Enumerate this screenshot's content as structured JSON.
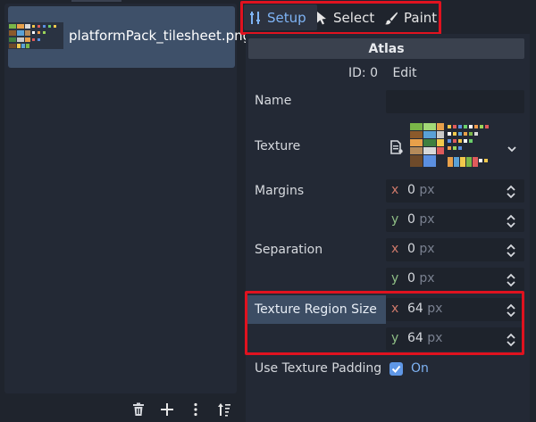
{
  "sidebar": {
    "atlas_item": {
      "name": "platformPack_tilesheet.png",
      "thumb_icon": "tilesheet-thumbnail"
    }
  },
  "bottom_toolbar": {
    "buttons": [
      {
        "icon": "trash-icon"
      },
      {
        "icon": "plus-icon"
      },
      {
        "icon": "kebab-menu-icon"
      },
      {
        "icon": "sort-icon"
      }
    ]
  },
  "mode_tabs": [
    {
      "label": "Setup",
      "icon": "setup-tools-icon",
      "active": true
    },
    {
      "label": "Select",
      "icon": "cursor-icon",
      "active": false
    },
    {
      "label": "Paint",
      "icon": "brush-icon",
      "active": false
    }
  ],
  "inspector": {
    "header": "Atlas",
    "id_label": "ID: 0",
    "edit_label": "Edit",
    "name": {
      "label": "Name",
      "value": ""
    },
    "texture": {
      "label": "Texture",
      "picker_icon": "texture-picker-icon",
      "dropdown_icon": "chevron-down-icon"
    },
    "margins": {
      "label": "Margins",
      "x": "0",
      "y": "0",
      "unit": "px"
    },
    "separation": {
      "label": "Separation",
      "x": "0",
      "y": "0",
      "unit": "px"
    },
    "texture_region_size": {
      "label": "Texture Region Size",
      "x": "64",
      "y": "64",
      "unit": "px"
    },
    "use_texture_padding": {
      "label": "Use Texture Padding",
      "checked": true,
      "value_label": "On"
    },
    "axis_x": "x",
    "axis_y": "y"
  },
  "colors": {
    "accent": "#7fb4f5",
    "highlight_red": "#e0121f",
    "selected_item": "#3e5069",
    "panel_bg": "#232935"
  }
}
